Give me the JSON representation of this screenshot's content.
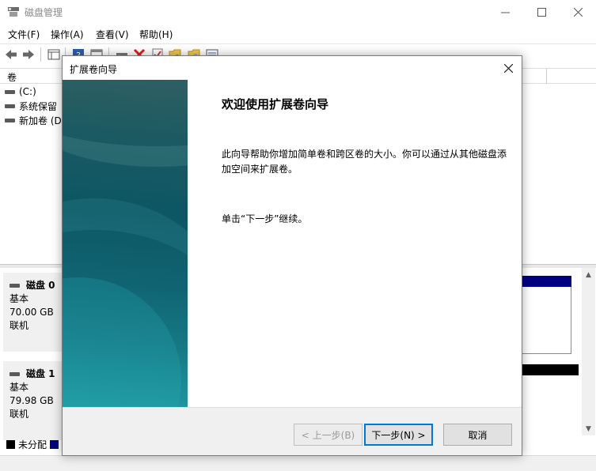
{
  "window": {
    "title": "磁盘管理",
    "icon": "disk-management-icon"
  },
  "menu": [
    "文件(F)",
    "操作(A)",
    "查看(V)",
    "帮助(H)"
  ],
  "toolbar": {
    "icons": [
      "back-arrow-icon",
      "forward-arrow-icon",
      "console-tree-icon",
      "help-icon",
      "properties-icon",
      "connect-drive-icon",
      "delete-icon",
      "checklist-icon",
      "folder-new-icon",
      "folder-search-icon",
      "list-view-icon"
    ]
  },
  "volume_list": {
    "header": "卷",
    "rows": [
      "(C:)",
      "系统保留",
      "新加卷 (D:"
    ]
  },
  "disks": [
    {
      "name": "磁盘 0",
      "type": "基本",
      "size": "70.00 GB",
      "status": "联机"
    },
    {
      "name": "磁盘 1",
      "type": "基本",
      "size": "79.98 GB",
      "status": "联机"
    }
  ],
  "legend": {
    "unallocated_label": "未分配",
    "unallocated_color": "#000000",
    "primary_color": "#000080"
  },
  "dialog": {
    "title": "扩展卷向导",
    "heading": "欢迎使用扩展卷向导",
    "description": "此向导帮助你增加简单卷和跨区卷的大小。你可以通过从其他磁盘添加空间来扩展卷。",
    "continue_text": "单击“下一步”继续。",
    "buttons": {
      "back": "< 上一步(B)",
      "next": "下一步(N) >",
      "cancel": "取消"
    }
  }
}
